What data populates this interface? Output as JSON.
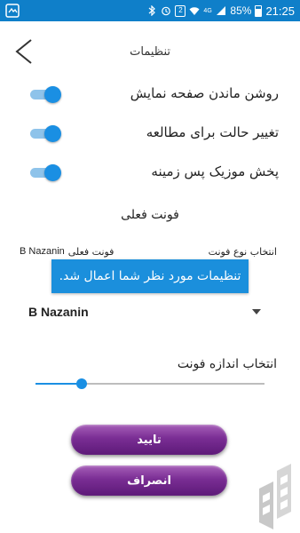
{
  "status_bar": {
    "network_badge": "2",
    "network_type": "4G",
    "battery": "85%",
    "time": "21:25"
  },
  "header": {
    "title": "تنظیمات"
  },
  "toggles": [
    {
      "label": "روشن ماندن صفحه نمایش",
      "on": true
    },
    {
      "label": "تغییر حالت برای مطالعه",
      "on": true
    },
    {
      "label": "پخش موزیک پس زمینه",
      "on": true
    }
  ],
  "font_section": {
    "heading": "فونت فعلی",
    "select_type_label": "انتخاب نوع فونت",
    "current_caption": "فونت فعلی",
    "current_value": "B Nazanin",
    "selected_font": "B Nazanin"
  },
  "toast": {
    "message": "تنظیمات مورد نظر شما اعمال شد."
  },
  "font_size": {
    "label": "انتخاب اندازه فونت",
    "level_fraction": 0.2
  },
  "buttons": {
    "confirm": "تایید",
    "cancel": "انصراف"
  },
  "colors": {
    "status_bar": "#0f7fc9",
    "accent": "#1a8fe3",
    "button": "#7a2d94"
  }
}
